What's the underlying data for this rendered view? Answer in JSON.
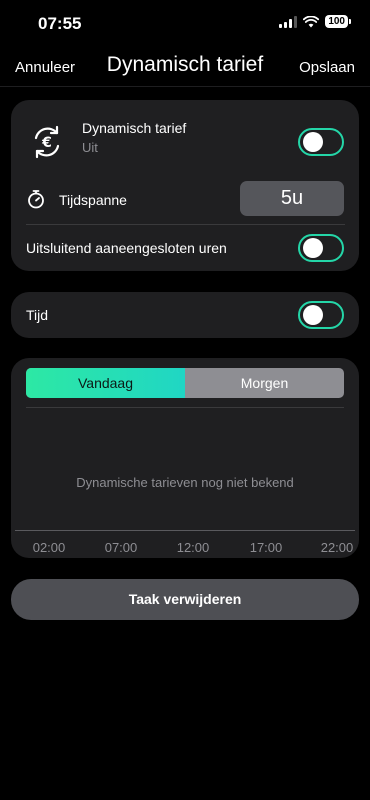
{
  "status": {
    "time": "07:55",
    "battery": "100"
  },
  "nav": {
    "cancel": "Annuleer",
    "title": "Dynamisch tarief",
    "save": "Opslaan"
  },
  "settings": {
    "dynamic": {
      "title": "Dynamisch tarief",
      "subtitle": "Uit",
      "toggle_on": false
    },
    "timespan": {
      "label": "Tijdspanne",
      "value": "5u"
    },
    "consecutive": {
      "label": "Uitsluitend aaneengesloten uren",
      "toggle_on": false
    }
  },
  "time_card": {
    "label": "Tijd",
    "toggle_on": false
  },
  "chart": {
    "tabs": [
      "Vandaag",
      "Morgen"
    ],
    "selected_tab": "Vandaag",
    "empty_message": "Dynamische tarieven nog niet bekend",
    "x_ticks": [
      "02:00",
      "07:00",
      "12:00",
      "17:00",
      "22:00"
    ]
  },
  "delete_label": "Taak verwijderen",
  "colors": {
    "accent": "#24d6a8",
    "card": "#1f1f21",
    "button": "#4e4f54"
  }
}
